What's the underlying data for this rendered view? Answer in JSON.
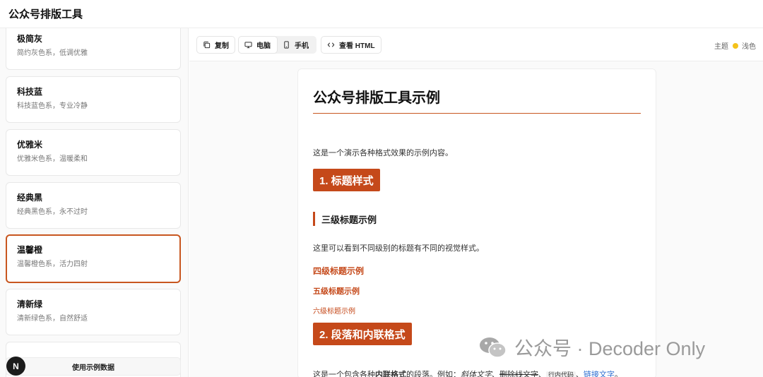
{
  "app": {
    "title": "公众号排版工具"
  },
  "sidebar": {
    "themes": [
      {
        "name": "极简灰",
        "desc": "简约灰色系，低调优雅"
      },
      {
        "name": "科技蓝",
        "desc": "科技蓝色系，专业冷静"
      },
      {
        "name": "优雅米",
        "desc": "优雅米色系，温暖柔和"
      },
      {
        "name": "经典黑",
        "desc": "经典黑色系，永不过时"
      },
      {
        "name": "温馨橙",
        "desc": "温馨橙色系，活力四射"
      },
      {
        "name": "清新绿",
        "desc": "清新绿色系，自然舒适"
      }
    ],
    "active_theme": "温馨橙",
    "sample_button": "使用示例数据",
    "avatar_letter": "N"
  },
  "toolbar": {
    "copy": "复制",
    "desktop": "电脑",
    "mobile": "手机",
    "view_html": "查看 HTML",
    "theme_label": "主题",
    "theme_mode": "浅色"
  },
  "preview": {
    "h1": "公众号排版工具示例",
    "intro": "这是一个演示各种格式效果的示例内容。",
    "h2_1": "1. 标题样式",
    "h3": "三级标题示例",
    "h3_para": "这里可以看到不同级别的标题有不同的视觉样式。",
    "h4": "四级标题示例",
    "h5": "五级标题示例",
    "h6": "六级标题示例",
    "h2_2": "2. 段落和内联格式",
    "inline_para": {
      "prefix": "这是一个包含各种",
      "bold": "内联格式",
      "mid": "的段落。例如：",
      "italic": "斜体文字",
      "sep1": "、",
      "strike": "删除线文字",
      "sep2": "、",
      "code": "行内代码",
      "sep3": "、",
      "link": "链接文字",
      "end": "。"
    }
  },
  "watermark": {
    "text": "公众号 · Decoder Only"
  },
  "colors": {
    "accent": "#c5491a",
    "link": "#2f6fd1"
  }
}
